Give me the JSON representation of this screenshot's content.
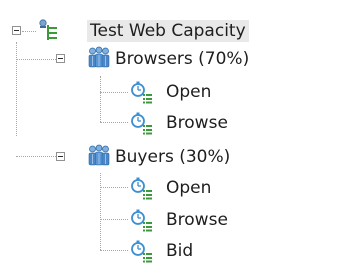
{
  "tree": {
    "root": {
      "label": "Test Web Capacity",
      "icon": "test-tree-icon",
      "expanded": true,
      "selected": true
    },
    "groups": [
      {
        "label": "Browsers (70%)",
        "icon": "user-group-icon",
        "expanded": true,
        "children": [
          {
            "label": "Open",
            "icon": "timed-script-icon"
          },
          {
            "label": "Browse",
            "icon": "timed-script-icon"
          }
        ]
      },
      {
        "label": "Buyers (30%)",
        "icon": "user-group-icon",
        "expanded": true,
        "children": [
          {
            "label": "Open",
            "icon": "timed-script-icon"
          },
          {
            "label": "Browse",
            "icon": "timed-script-icon"
          },
          {
            "label": "Bid",
            "icon": "timed-script-icon"
          }
        ]
      }
    ]
  },
  "colors": {
    "connector": "#a8a8a8",
    "selection": "#e9e9e9",
    "group_icon": "#4a86c8",
    "timer_icon": "#3b8fd0",
    "list_icon": "#3c9a3c"
  }
}
